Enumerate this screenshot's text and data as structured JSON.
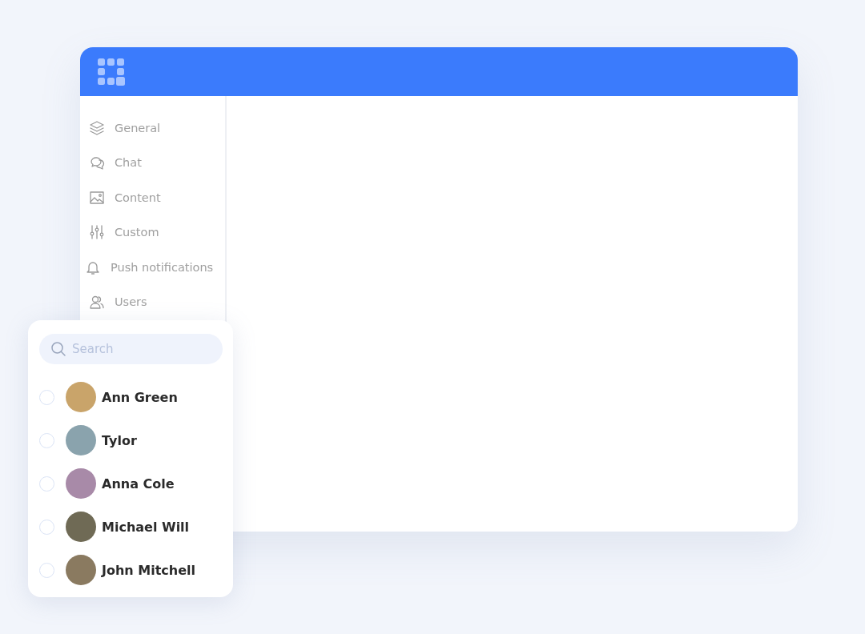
{
  "sidebar": {
    "items": [
      {
        "label": "General",
        "kind": "layers"
      },
      {
        "label": "Chat",
        "kind": "chat"
      },
      {
        "label": "Content",
        "kind": "image"
      },
      {
        "label": "Custom",
        "kind": "sliders"
      },
      {
        "label": "Push notifications",
        "kind": "bell"
      },
      {
        "label": "Users",
        "kind": "users"
      }
    ]
  },
  "user_picker": {
    "search": {
      "placeholder": "Search"
    },
    "users": [
      {
        "name": "Ann Green",
        "selected": false
      },
      {
        "name": "Tylor",
        "selected": false
      },
      {
        "name": "Anna Cole",
        "selected": false
      },
      {
        "name": "Michael Will",
        "selected": false
      },
      {
        "name": "John Mitchell",
        "selected": false
      }
    ]
  }
}
